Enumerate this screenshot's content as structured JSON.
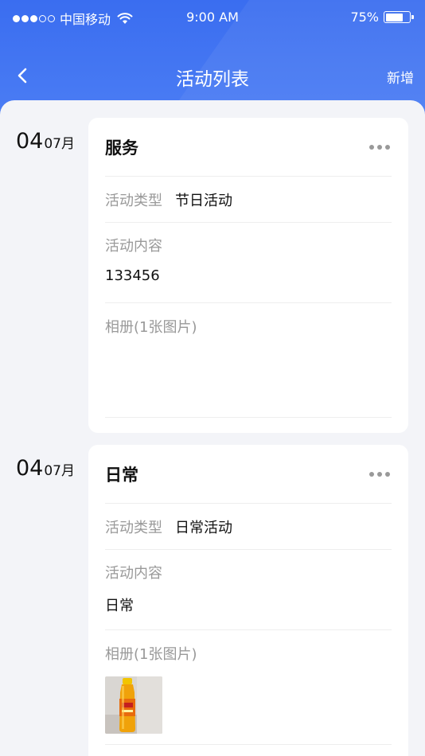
{
  "status_bar": {
    "carrier": "中国移动",
    "time": "9:00 AM",
    "battery_percent": "75%",
    "battery_level": 0.75
  },
  "nav": {
    "title": "活动列表",
    "action": "新增",
    "back_icon": "chevron-left-icon"
  },
  "activities": [
    {
      "day": "04",
      "month": "07月",
      "title": "服务",
      "type_label": "活动类型",
      "type_value": "节日活动",
      "content_label": "活动内容",
      "content_value": "133456",
      "album_label": "相册(1张图片)",
      "has_thumbnail": false
    },
    {
      "day": "04",
      "month": "07月",
      "title": "日常",
      "type_label": "活动类型",
      "type_value": "日常活动",
      "content_label": "活动内容",
      "content_value": "日常",
      "album_label": "相册(1张图片)",
      "has_thumbnail": true
    }
  ],
  "colors": {
    "header": "#3a6df0",
    "background": "#f3f4f8"
  }
}
